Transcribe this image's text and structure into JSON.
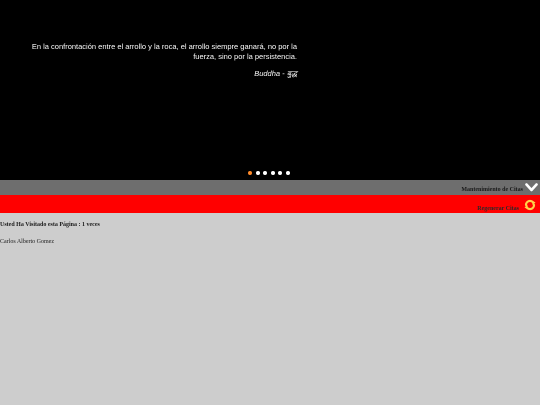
{
  "slider": {
    "quote": "En la confrontación entre el arrollo y la roca, el arrollo siempre ganará, no por la fuerza, sino por la persistencia.",
    "author": "Buddha - बुद्ध",
    "dot_count": 6,
    "active_dot": 1
  },
  "toolbar": {
    "maintenance_label": "Mantenimiento de Citas",
    "regenerate_label": "Regenerar Citas"
  },
  "footer": {
    "visits_text": "Usted Ha Visitado esta Página : 1 veces",
    "author_name": "Carlos Alberto Gomez"
  },
  "colors": {
    "slider_bg": "#000000",
    "grey_bar": "#6e6e6e",
    "red_bar": "#ff0000",
    "page_bg": "#cdcdcd",
    "active_dot": "#ff8a2a"
  }
}
